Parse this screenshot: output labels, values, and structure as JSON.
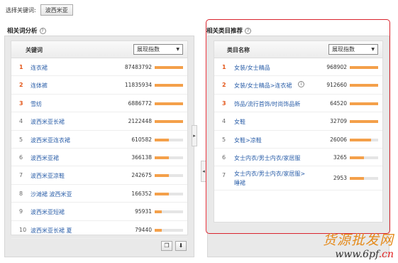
{
  "topbar": {
    "label": "选择关键词:",
    "keyword": "波西米亚"
  },
  "left": {
    "title": "相关词分析",
    "col_keyword": "关键词",
    "select_value": "展现指数",
    "rows": [
      {
        "rank": "1",
        "name": "连衣裙",
        "value": "87483792",
        "fill": 1.0
      },
      {
        "rank": "2",
        "name": "连体裤",
        "value": "11835934",
        "fill": 1.0
      },
      {
        "rank": "3",
        "name": "雪纺",
        "value": "6886772",
        "fill": 1.0
      },
      {
        "rank": "4",
        "name": "波西米亚长裙",
        "value": "2122448",
        "fill": 1.0
      },
      {
        "rank": "5",
        "name": "波西米亚连衣裙",
        "value": "610582",
        "fill": 0.5
      },
      {
        "rank": "6",
        "name": "波西米亚裙",
        "value": "366138",
        "fill": 0.5
      },
      {
        "rank": "7",
        "name": "波西米亚凉鞋",
        "value": "242675",
        "fill": 0.5
      },
      {
        "rank": "8",
        "name": "沙滩裙 波西米亚",
        "value": "166352",
        "fill": 0.5
      },
      {
        "rank": "9",
        "name": "波西米亚短裙",
        "value": "95931",
        "fill": 0.25
      },
      {
        "rank": "10",
        "name": "波西米亚长裙 夏",
        "value": "79440",
        "fill": 0.25
      }
    ],
    "footer_icons": [
      "copy-icon",
      "download-icon"
    ]
  },
  "right": {
    "title": "相关类目推荐",
    "col_category": "类目名称",
    "select_value": "展现指数",
    "rows": [
      {
        "rank": "1",
        "name": "女装/女士精品",
        "value": "968902",
        "fill": 1.0
      },
      {
        "rank": "2",
        "name": "女装/女士精品>连衣裙",
        "value": "912660",
        "fill": 1.0
      },
      {
        "rank": "3",
        "name": "饰品/流行首饰/时尚饰品新",
        "value": "64520",
        "fill": 1.0
      },
      {
        "rank": "4",
        "name": "女鞋",
        "value": "32709",
        "fill": 1.0
      },
      {
        "rank": "5",
        "name": "女鞋>凉鞋",
        "value": "26006",
        "fill": 0.75
      },
      {
        "rank": "6",
        "name": "女士内衣/男士内衣/家居服",
        "value": "3265",
        "fill": 0.5
      },
      {
        "rank": "7",
        "name": "女士内衣/男士内衣/家居服>",
        "name2": "睡裙",
        "value": "2953",
        "fill": 0.5
      }
    ]
  },
  "watermark": {
    "line1": "货源批发网",
    "line2_a": "www.6pf",
    "line2_b": ".cn"
  },
  "colors": {
    "bar": "#f4a04a",
    "link": "#2a5ea8",
    "rank_top": "#e4571a",
    "highlight_box": "#d9232d"
  }
}
